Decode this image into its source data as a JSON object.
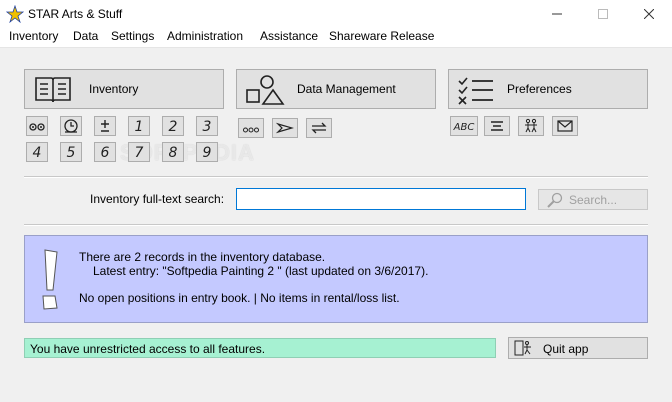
{
  "window": {
    "title": "STAR Arts & Stuff",
    "icon": "star-logo-icon"
  },
  "menu": [
    {
      "label": "Inventory"
    },
    {
      "label": "Data"
    },
    {
      "label": "Settings"
    },
    {
      "label": "Administration"
    },
    {
      "label": "Assistance"
    },
    {
      "label": "Shareware Release"
    }
  ],
  "sections": {
    "inventory": {
      "label": "Inventory",
      "icon": "book-icon"
    },
    "data_management": {
      "label": "Data Management",
      "icon": "shapes-icon"
    },
    "preferences": {
      "label": "Preferences",
      "icon": "checklist-icon"
    }
  },
  "quick_buttons": {
    "inventory_row1": [
      "eyes-icon",
      "clock-icon",
      "plus-minus-icon",
      "1",
      "2",
      "3"
    ],
    "inventory_row2": [
      "4",
      "5",
      "6",
      "7",
      "8",
      "9"
    ],
    "data": [
      "dots-icon",
      "send-arrow-icon",
      "sync-arrows-icon"
    ],
    "preferences": [
      "abc-icon",
      "lines-icon",
      "people-icon",
      "mail-icon"
    ]
  },
  "search": {
    "label": "Inventory full-text search:",
    "value": "",
    "button_label": "Search..."
  },
  "info": {
    "icon": "exclamation-icon",
    "line1": "There are 2 records in the inventory database.",
    "line2": "Latest entry: \"Softpedia Painting 2 \" (last updated on 3/6/2017).",
    "line3": "No open positions in entry book. | No items in rental/loss list."
  },
  "status": {
    "text": "You have unrestricted access to all features."
  },
  "quit": {
    "label": "Quit app",
    "icon": "exit-icon"
  },
  "watermark": "SOFTPEDIA",
  "colors": {
    "info_bg": "#c4c9ff",
    "status_bg": "#a6f1d2",
    "focus_border": "#0078d7"
  }
}
